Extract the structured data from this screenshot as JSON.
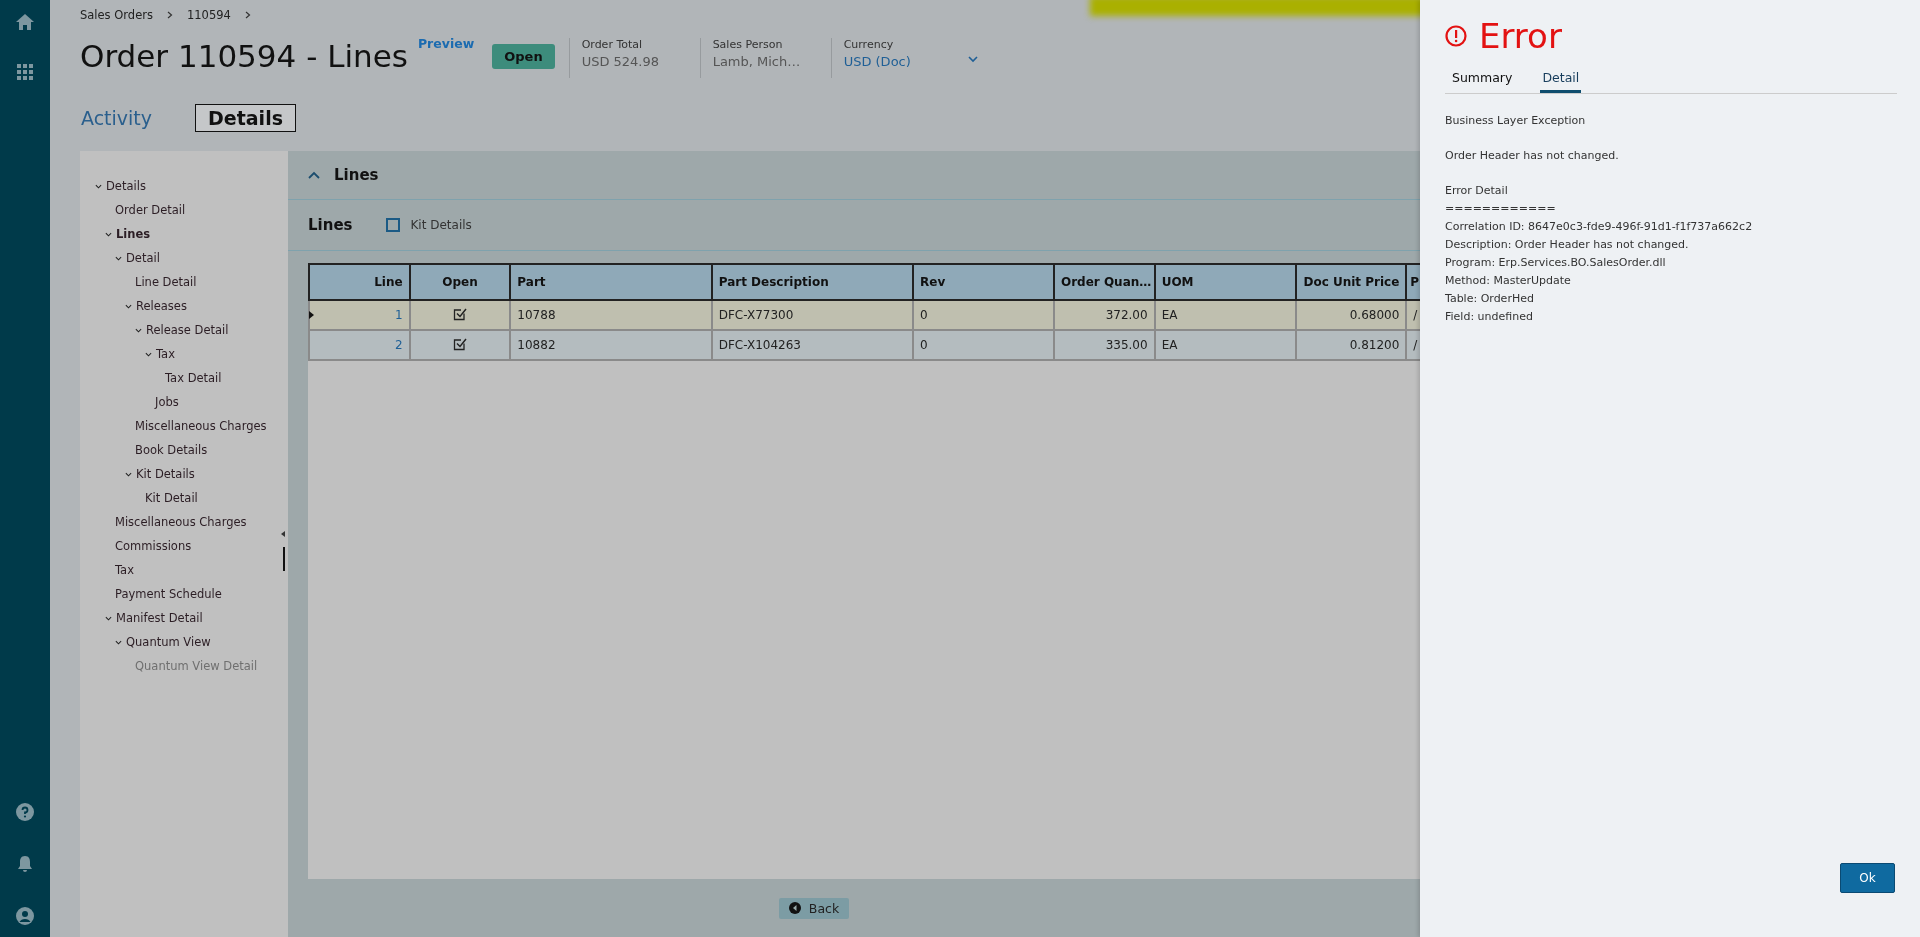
{
  "breadcrumb": [
    {
      "label": "Sales Orders"
    },
    {
      "label": "110594"
    }
  ],
  "header": {
    "title": "Order 110594 - Lines",
    "preview_link": "Preview",
    "status_badge": "Open",
    "fields": [
      {
        "label": "Order Total",
        "value": "USD  524.98",
        "kind": "text"
      },
      {
        "label": "Sales Person",
        "value": "Lamb, Mich…",
        "kind": "text"
      },
      {
        "label": "Currency",
        "value": "USD (Doc)",
        "kind": "link"
      }
    ]
  },
  "page_tabs": [
    {
      "label": "Activity",
      "selected": false
    },
    {
      "label": "Details",
      "selected": true
    }
  ],
  "tree": [
    {
      "label": "Details",
      "expanded": true,
      "selected": false,
      "disabled": false,
      "children": [
        {
          "label": "Order Detail",
          "selected": false,
          "disabled": false
        },
        {
          "label": "Lines",
          "expanded": true,
          "selected": true,
          "disabled": false,
          "children": [
            {
              "label": "Detail",
              "expanded": true,
              "selected": false,
              "disabled": false,
              "children": [
                {
                  "label": "Line Detail",
                  "selected": false,
                  "disabled": false
                },
                {
                  "label": "Releases",
                  "expanded": true,
                  "selected": false,
                  "disabled": false,
                  "children": [
                    {
                      "label": "Release Detail",
                      "expanded": true,
                      "selected": false,
                      "disabled": false,
                      "children": [
                        {
                          "label": "Tax",
                          "expanded": true,
                          "selected": false,
                          "disabled": false,
                          "children": [
                            {
                              "label": "Tax Detail",
                              "selected": false,
                              "disabled": false
                            }
                          ]
                        },
                        {
                          "label": "Jobs",
                          "selected": false,
                          "disabled": false
                        }
                      ]
                    }
                  ]
                },
                {
                  "label": "Miscellaneous Charges",
                  "selected": false,
                  "disabled": false
                },
                {
                  "label": "Book Details",
                  "selected": false,
                  "disabled": false
                },
                {
                  "label": "Kit Details",
                  "expanded": true,
                  "selected": false,
                  "disabled": false,
                  "children": [
                    {
                      "label": "Kit Detail",
                      "selected": false,
                      "disabled": false
                    }
                  ]
                }
              ]
            }
          ]
        },
        {
          "label": "Miscellaneous Charges",
          "selected": false,
          "disabled": false
        },
        {
          "label": "Commissions",
          "selected": false,
          "disabled": false
        },
        {
          "label": "Tax",
          "selected": false,
          "disabled": false
        },
        {
          "label": "Payment Schedule",
          "selected": false,
          "disabled": false
        },
        {
          "label": "Manifest Detail",
          "expanded": true,
          "selected": false,
          "disabled": false,
          "children": [
            {
              "label": "Quantum View",
              "expanded": true,
              "selected": false,
              "disabled": false,
              "children": [
                {
                  "label": "Quantum View Detail",
                  "selected": false,
                  "disabled": true
                }
              ]
            }
          ]
        }
      ]
    }
  ],
  "lines_panel": {
    "title": "Lines",
    "expanded": true,
    "subtitle": "Lines",
    "kit_details": {
      "label": "Kit Details",
      "checked": false
    },
    "table": {
      "columns": [
        {
          "label": "Line"
        },
        {
          "label": "Open"
        },
        {
          "label": "Part"
        },
        {
          "label": "Part Description"
        },
        {
          "label": "Rev"
        },
        {
          "label": "Order Quan…"
        },
        {
          "label": "UOM"
        },
        {
          "label": "Doc Unit Price"
        },
        {
          "label": "P"
        }
      ],
      "rows": [
        {
          "selected": true,
          "line": "1",
          "open": true,
          "part": "10788",
          "description": "DFC-X77300",
          "rev": "0",
          "quantity": "372.00",
          "uom": "EA",
          "unit_price": "0.68000",
          "column_9": "/"
        },
        {
          "selected": false,
          "line": "2",
          "open": true,
          "part": "10882",
          "description": "DFC-X104263",
          "rev": "0",
          "quantity": "335.00",
          "uom": "EA",
          "unit_price": "0.81200",
          "column_9": "/"
        }
      ]
    },
    "back_button": "Back"
  },
  "error_panel": {
    "title": "Error",
    "tabs": [
      {
        "label": "Summary",
        "selected": false
      },
      {
        "label": "Detail",
        "selected": true
      }
    ],
    "paragraphs": [
      {
        "lines": [
          "Business Layer Exception"
        ]
      },
      {
        "lines": [
          "Order Header has not changed."
        ]
      },
      {
        "lines": [
          "Error Detail",
          "============",
          "Correlation ID: 8647e0c3-fde9-496f-91d1-f1f737a662c2",
          "Description: Order Header has not changed.",
          "Program: Erp.Services.BO.SalesOrder.dll",
          "Method: MasterUpdate",
          "Table: OrderHed",
          "Field: undefined"
        ]
      }
    ],
    "ok_button": "Ok"
  }
}
